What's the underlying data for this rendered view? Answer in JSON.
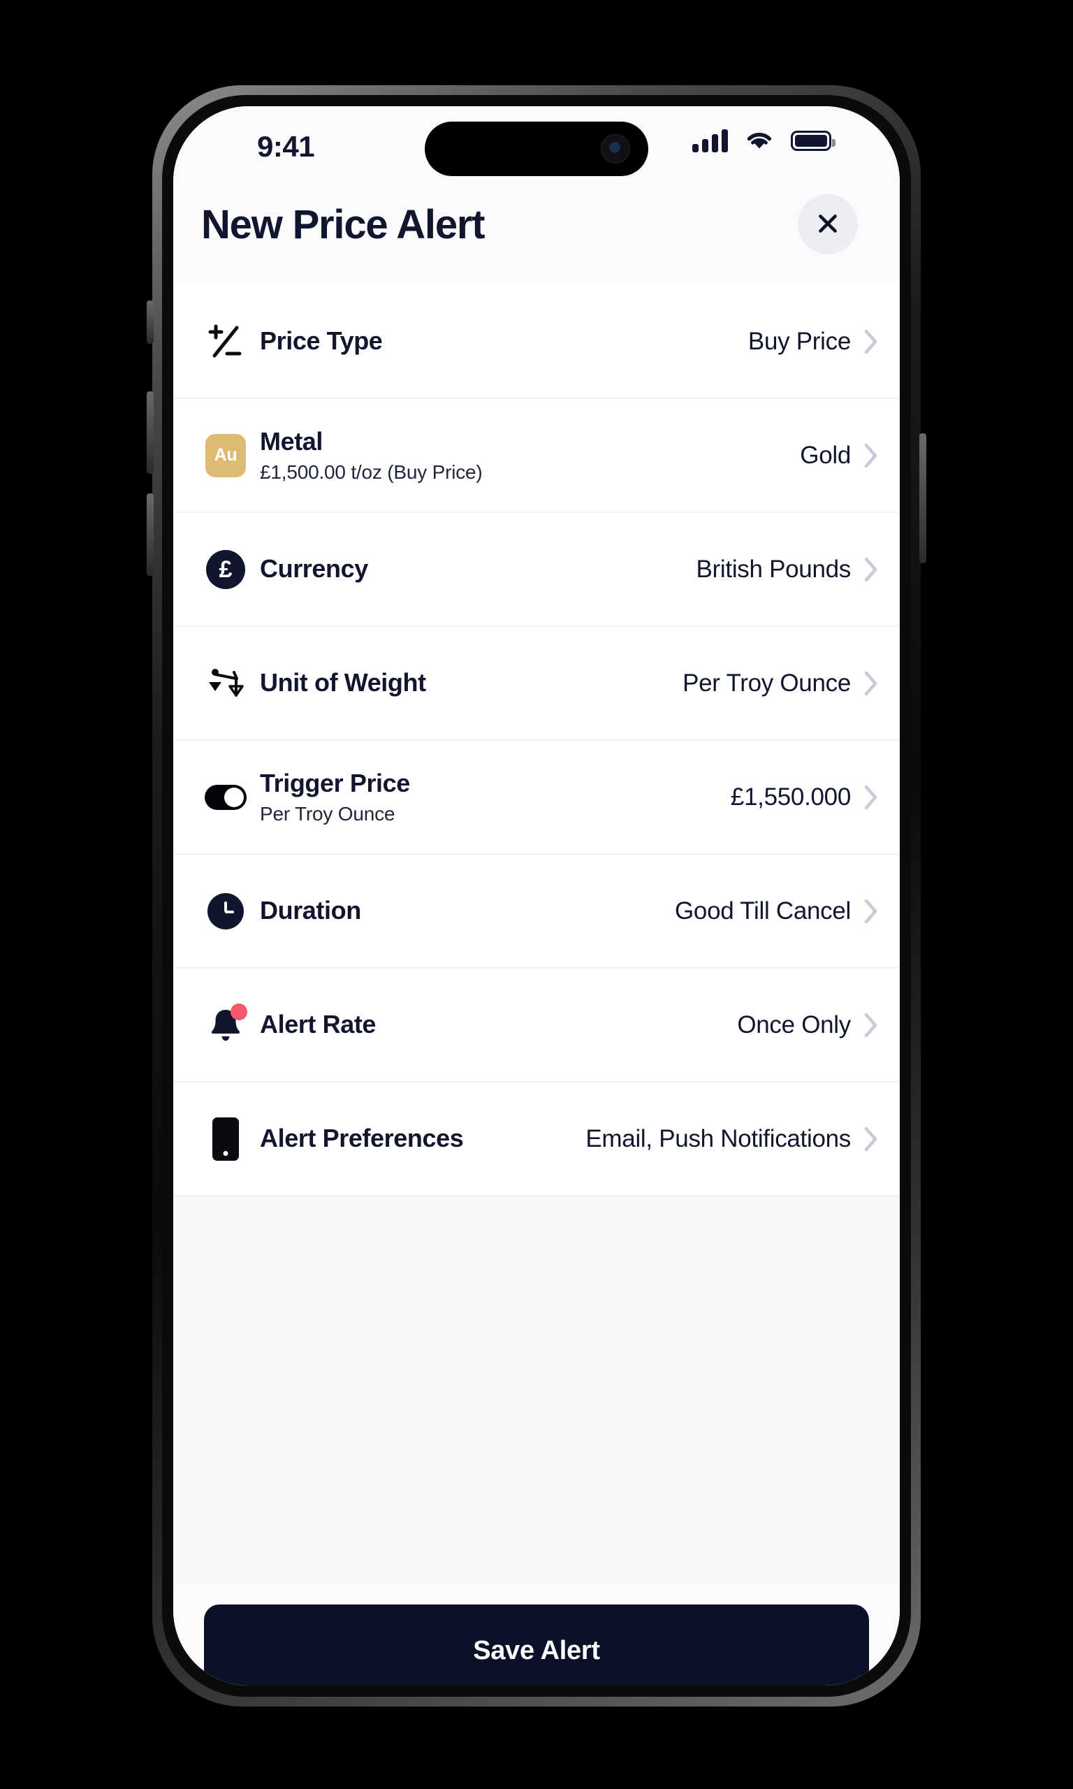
{
  "status_bar": {
    "time": "9:41",
    "icons": [
      "cellular-signal-icon",
      "wifi-icon",
      "battery-icon"
    ]
  },
  "header": {
    "title": "New Price Alert",
    "close_label": "close-icon"
  },
  "colors": {
    "primary_dark": "#0c1029",
    "gold": "#ddbc72",
    "badge_red": "#f4596b",
    "chevron": "#c8ccd6",
    "screen_bg": "#ffffff",
    "panel_bg": "#f7f8fa"
  },
  "rows": [
    {
      "icon": "plus-minus-icon",
      "label": "Price Type",
      "sub": "",
      "value": "Buy Price"
    },
    {
      "icon": "metal-au-badge-icon",
      "icon_text": "Au",
      "label": "Metal",
      "sub": "£1,500.00 t/oz (Buy Price)",
      "value": "Gold"
    },
    {
      "icon": "pound-currency-icon",
      "icon_text": "£",
      "label": "Currency",
      "sub": "",
      "value": "British Pounds"
    },
    {
      "icon": "scales-icon",
      "label": "Unit of Weight",
      "sub": "",
      "value": "Per Troy Ounce"
    },
    {
      "icon": "toggle-icon",
      "label": "Trigger Price",
      "sub": "Per Troy Ounce",
      "value": "£1,550.000"
    },
    {
      "icon": "clock-icon",
      "label": "Duration",
      "sub": "",
      "value": "Good Till Cancel"
    },
    {
      "icon": "bell-icon",
      "label": "Alert Rate",
      "sub": "",
      "value": "Once Only"
    },
    {
      "icon": "mobile-phone-icon",
      "label": "Alert Preferences",
      "sub": "",
      "value": "Email, Push Notifications"
    }
  ],
  "footer": {
    "save_label": "Save Alert"
  }
}
